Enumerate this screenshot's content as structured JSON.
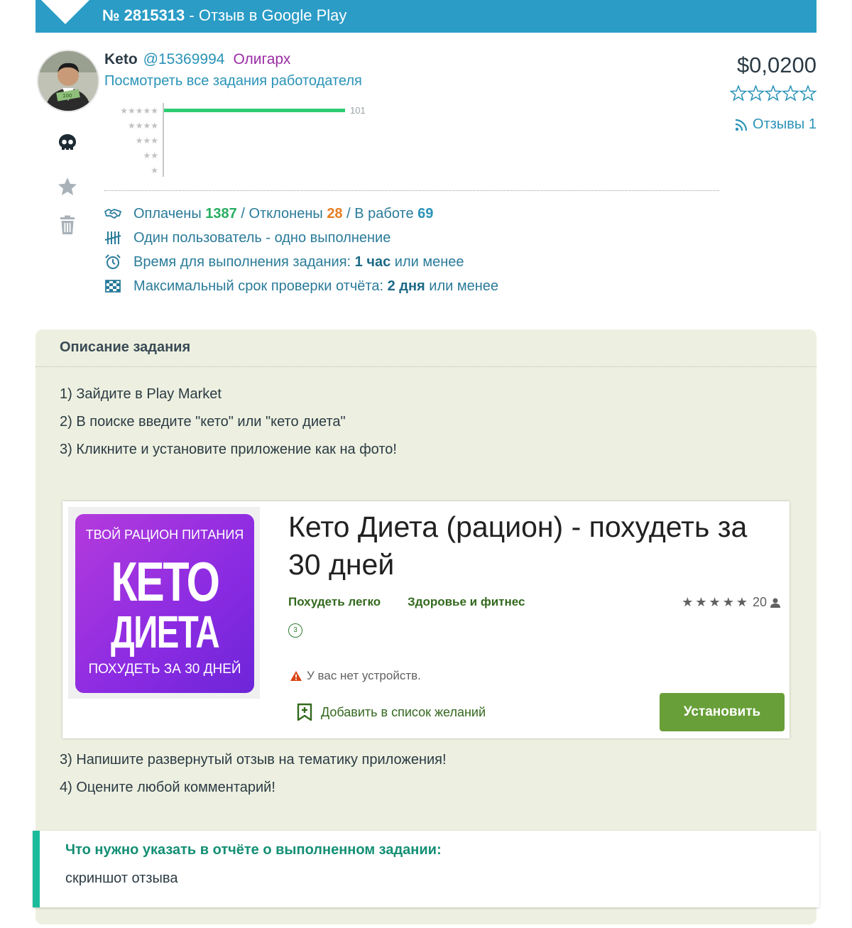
{
  "header": {
    "task_number": "№ 2815313",
    "task_type": " - Отзыв в Google Play",
    "color": "#2a9cc6"
  },
  "employer": {
    "name": "Keto",
    "id": "@15369994",
    "rank": "Олигарх",
    "all_tasks_link": "Посмотреть все задания работодателя",
    "avatar_icon": "user-avatar-photo"
  },
  "rating_breakdown": {
    "rows": [
      {
        "stars": "★★★★★",
        "count": 101,
        "label": "101"
      },
      {
        "stars": "★★★★",
        "count": 0,
        "label": ""
      },
      {
        "stars": "★★★",
        "count": 0,
        "label": ""
      },
      {
        "stars": "★★",
        "count": 0,
        "label": ""
      },
      {
        "stars": "★",
        "count": 0,
        "label": ""
      }
    ],
    "bar_color": "#2ecc71"
  },
  "side_icons": [
    "skull-icon",
    "star-icon",
    "trash-icon"
  ],
  "price": "$0,0200",
  "employer_stars_outline": "☆☆☆☆☆",
  "reviews_link": "Отзывы 1",
  "stats": {
    "paid_label": "Оплачены",
    "paid_value": "1387",
    "sep1": "/",
    "rejected_label": "Отклонены",
    "rejected_value": "28",
    "sep2": "/",
    "inwork_label": "В работе",
    "inwork_value": "69",
    "one_user": "Один пользователь - одно выполнение",
    "time_label": "Время для выполнения задания:",
    "time_value": "1 час",
    "time_suffix": "или менее",
    "check_label": "Максимальный срок проверки отчёта:",
    "check_value": "2 дня",
    "check_suffix": "или менее"
  },
  "description": {
    "title": "Описание задания",
    "lines_before": [
      "1) Зайдите в Play Market",
      "2) В поиске введите \"кето\" или \"кето диета\"",
      "3) Кликните и установите приложение как на фото!"
    ],
    "lines_after": [
      "3) Напишите развернутый отзыв на тематику приложения!",
      "4) Оцените любой комментарий!"
    ],
    "background": "#edf0e0"
  },
  "app_listing": {
    "image_text_top": "ТВОЙ РАЦИОН ПИТАНИЯ",
    "image_text_big1": "КЕТО",
    "image_text_big2": "ДИЕТА",
    "image_text_bottom": "ПОХУДЕТЬ ЗА 30 ДНЕЙ",
    "title": "Кето Диета (рацион) - похудеть за 30 дней",
    "developer": "Похудеть легко",
    "category": "Здоровье и фитнес",
    "rating_stars": "★★★★★",
    "rating_count": "20",
    "age_rating": "3",
    "no_devices": "У вас нет устройств.",
    "wishlist": "Добавить в список желаний",
    "install_button": "Установить",
    "install_color": "#689f38"
  },
  "report": {
    "title": "Что нужно указать в отчёте о выполненном задании:",
    "text": "скриншот отзыва",
    "accent_color": "#1abc9c"
  }
}
